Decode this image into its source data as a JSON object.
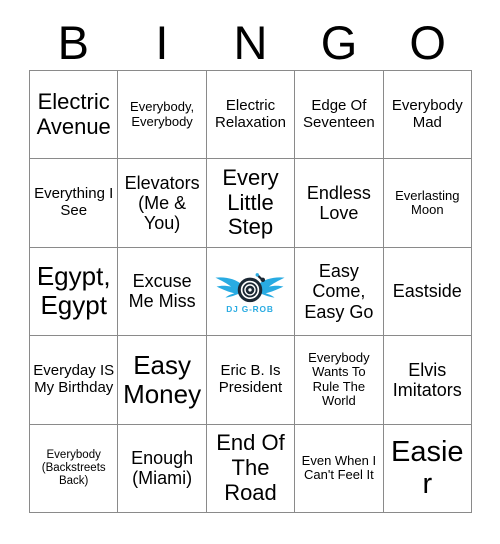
{
  "card": {
    "title": "BINGO Card",
    "header_letters": [
      "B",
      "I",
      "N",
      "G",
      "O"
    ],
    "grid_size": "5x5",
    "colors": {
      "grid_line": "#8a8a8a",
      "text": "#000000",
      "background": "#ffffff",
      "logo_blue": "#29ABE2",
      "logo_dark": "#1b2733"
    },
    "free_space": {
      "type": "logo",
      "icon_name": "dj-grob-logo-icon",
      "brand_text": "DJ G-ROB",
      "description": "winged turntable record logo"
    },
    "rows": [
      [
        {
          "text": "Electric Avenue",
          "size": "l"
        },
        {
          "text": "Everybody, Everybody",
          "size": "xs"
        },
        {
          "text": "Electric Relaxation",
          "size": "s"
        },
        {
          "text": "Edge Of Seventeen",
          "size": "s"
        },
        {
          "text": "Everybody Mad",
          "size": "s"
        }
      ],
      [
        {
          "text": "Everything I See",
          "size": "s"
        },
        {
          "text": "Elevators (Me & You)",
          "size": "m"
        },
        {
          "text": "Every Little Step",
          "size": "l"
        },
        {
          "text": "Endless Love",
          "size": "m"
        },
        {
          "text": "Everlasting Moon",
          "size": "xs"
        }
      ],
      [
        {
          "text": "Egypt, Egypt",
          "size": "xl"
        },
        {
          "text": "Excuse Me Miss",
          "size": "m"
        },
        {
          "text": "",
          "size": "m",
          "is_free": true
        },
        {
          "text": "Easy Come, Easy Go",
          "size": "m"
        },
        {
          "text": "Eastside",
          "size": "m"
        }
      ],
      [
        {
          "text": "Everyday IS My Birthday",
          "size": "s"
        },
        {
          "text": "Easy Money",
          "size": "xl"
        },
        {
          "text": "Eric B. Is President",
          "size": "s"
        },
        {
          "text": "Everybody Wants To Rule The World",
          "size": "xs"
        },
        {
          "text": "Elvis Imitators",
          "size": "m"
        }
      ],
      [
        {
          "text": "Everybody (Backstreets Back)",
          "size": "xxs"
        },
        {
          "text": "Enough (Miami)",
          "size": "m"
        },
        {
          "text": "End Of The Road",
          "size": "l"
        },
        {
          "text": "Even When I Can't Feel It",
          "size": "xs"
        },
        {
          "text": "Easier",
          "size": "xxl"
        }
      ]
    ]
  }
}
